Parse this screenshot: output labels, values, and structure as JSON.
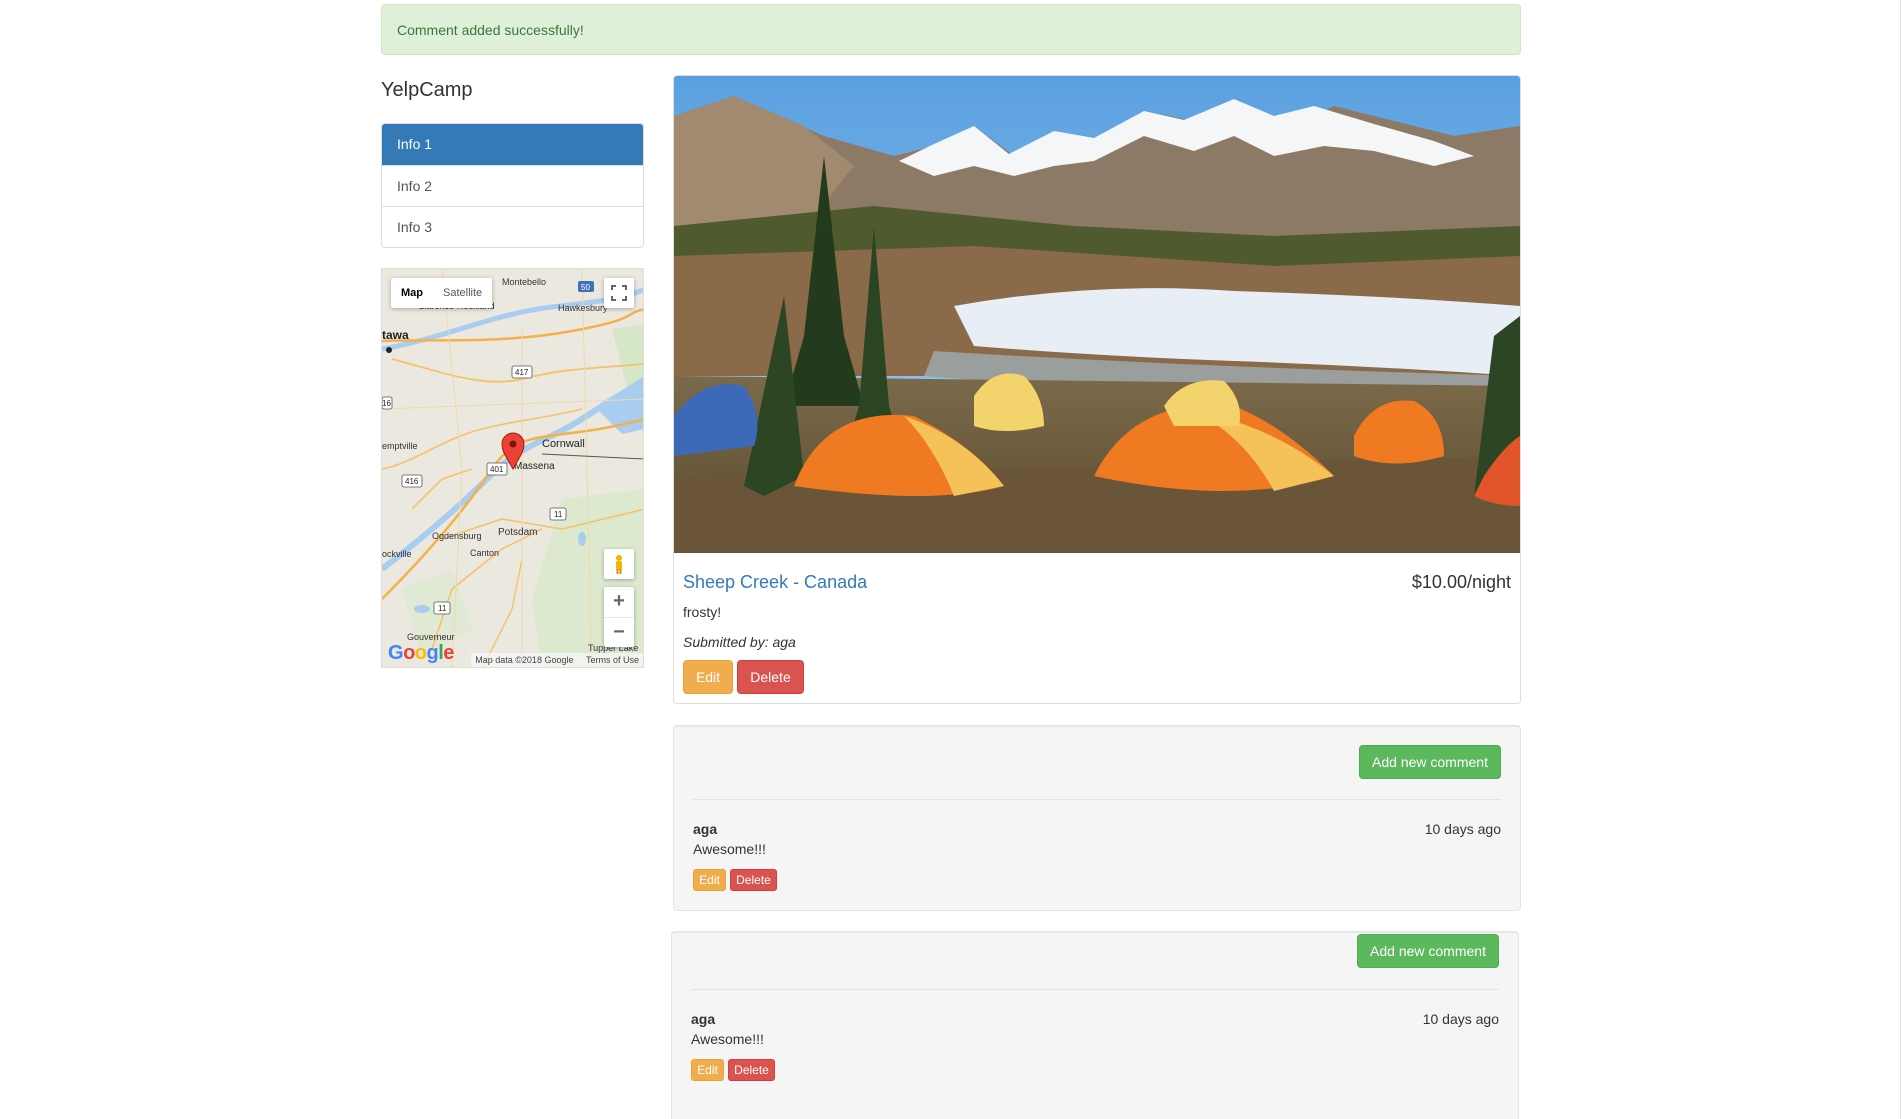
{
  "alert": {
    "message": "Comment added successfully!"
  },
  "sidebar": {
    "brand": "YelpCamp",
    "items": [
      {
        "label": "Info 1",
        "active": true
      },
      {
        "label": "Info 2",
        "active": false
      },
      {
        "label": "Info 3",
        "active": false
      }
    ]
  },
  "map": {
    "type_map": "Map",
    "type_satellite": "Satellite",
    "zoom_in": "+",
    "zoom_out": "−",
    "attribution": "Map data ©2018 Google",
    "terms": "Terms of Use",
    "logo": [
      "G",
      "o",
      "o",
      "g",
      "l",
      "e"
    ],
    "labels": {
      "montebello": "Montebello",
      "clarence_rockland": "Clarence-Rockland",
      "hawkesbury": "Hawkesbury",
      "ottawa": "tawa",
      "cornwall": "Cornwall",
      "massena": "Massena",
      "kemptville": "emptville",
      "ogdensburg": "Ogdensburg",
      "potsdam": "Potsdam",
      "canton": "Canton",
      "brockville": "ockville",
      "gouverneur": "Gouverneur",
      "tupper_lake": "Tupper Lake"
    },
    "route_shields": {
      "r50": "50",
      "r417": "417",
      "r16": "16",
      "r401": "401",
      "r416": "416",
      "r11a": "11",
      "r11b": "11"
    }
  },
  "campground": {
    "name": "Sheep Creek - Canada",
    "price": "$10.00/night",
    "description": "frosty!",
    "submitted_by": "Submitted by: aga",
    "edit_label": "Edit",
    "delete_label": "Delete"
  },
  "comments_sections": [
    {
      "add_label": "Add new comment",
      "comments": [
        {
          "author": "aga",
          "time": "10 days ago",
          "text": "Awesome!!!",
          "edit_label": "Edit",
          "delete_label": "Delete"
        }
      ]
    },
    {
      "add_label": "Add new comment",
      "comments": [
        {
          "author": "aga",
          "time": "10 days ago",
          "text": "Awesome!!!",
          "edit_label": "Edit",
          "delete_label": "Delete"
        }
      ]
    }
  ],
  "colors": {
    "primary": "#337ab7",
    "success": "#5cb85c",
    "warning": "#f0ad4e",
    "danger": "#d9534f",
    "alert_bg": "#dff0d8",
    "alert_text": "#3c763d"
  }
}
